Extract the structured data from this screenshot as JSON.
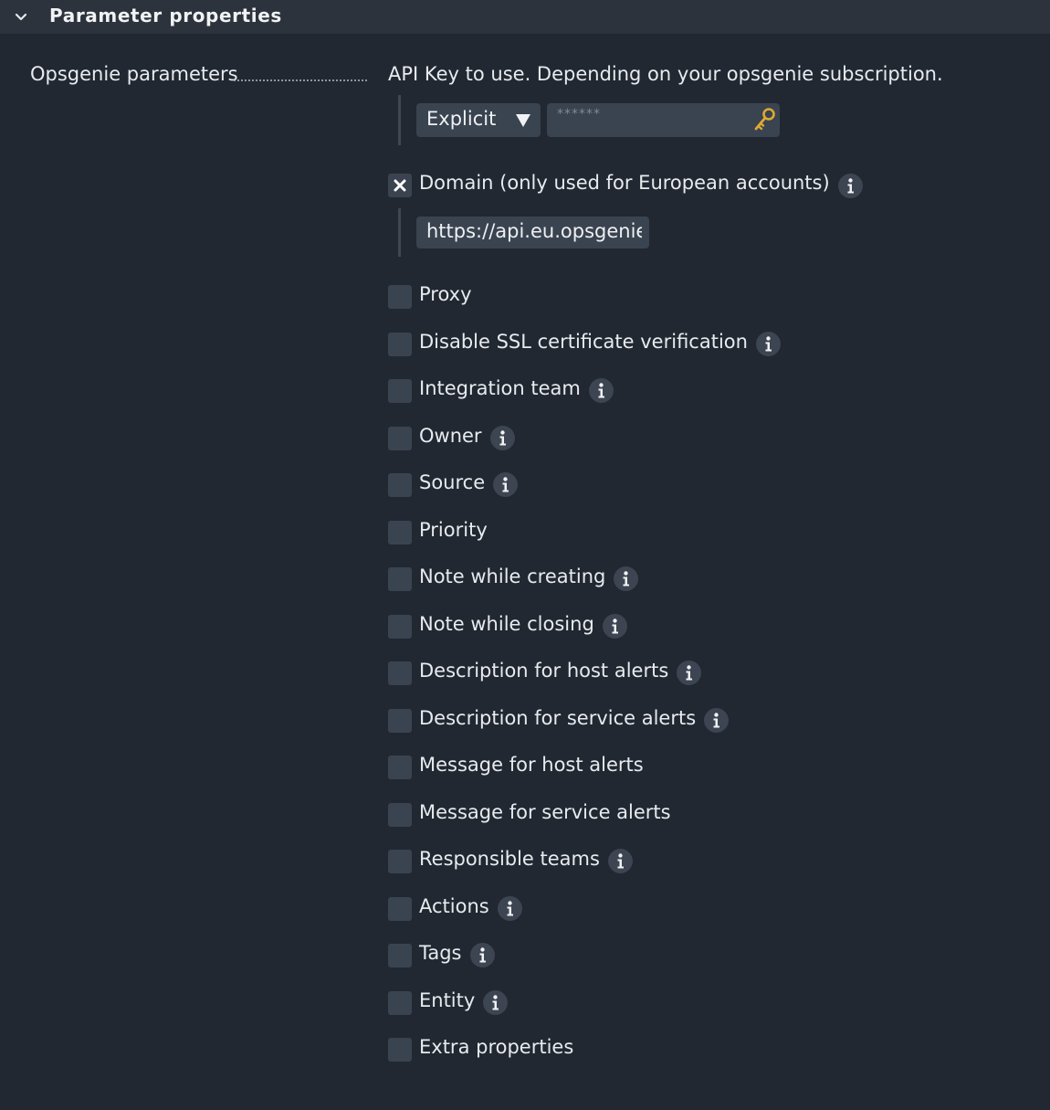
{
  "section": {
    "title": "Parameter properties"
  },
  "param": {
    "label": "Opsgenie parameters"
  },
  "api_key": {
    "description": "API Key to use. Depending on your opsgenie subscription.",
    "select_value": "Explicit",
    "password_mask": "******"
  },
  "domain": {
    "label": "Domain (only used for European accounts)",
    "checked": true,
    "url_value": "https://api.eu.opsgenie.com"
  },
  "options": [
    {
      "label": "Proxy",
      "info": false
    },
    {
      "label": "Disable SSL certificate verification",
      "info": true
    },
    {
      "label": "Integration team",
      "info": true
    },
    {
      "label": "Owner",
      "info": true
    },
    {
      "label": "Source",
      "info": true
    },
    {
      "label": "Priority",
      "info": false
    },
    {
      "label": "Note while creating",
      "info": true
    },
    {
      "label": "Note while closing",
      "info": true
    },
    {
      "label": "Description for host alerts",
      "info": true
    },
    {
      "label": "Description for service alerts",
      "info": true
    },
    {
      "label": "Message for host alerts",
      "info": false
    },
    {
      "label": "Message for service alerts",
      "info": false
    },
    {
      "label": "Responsible teams",
      "info": true
    },
    {
      "label": "Actions",
      "info": true
    },
    {
      "label": "Tags",
      "info": true
    },
    {
      "label": "Entity",
      "info": true
    },
    {
      "label": "Extra properties",
      "info": false
    }
  ],
  "colors": {
    "background": "#212832",
    "header": "#2c333c",
    "input": "#3a4350",
    "text": "#e8ebee",
    "key_icon": "#e0a930"
  }
}
